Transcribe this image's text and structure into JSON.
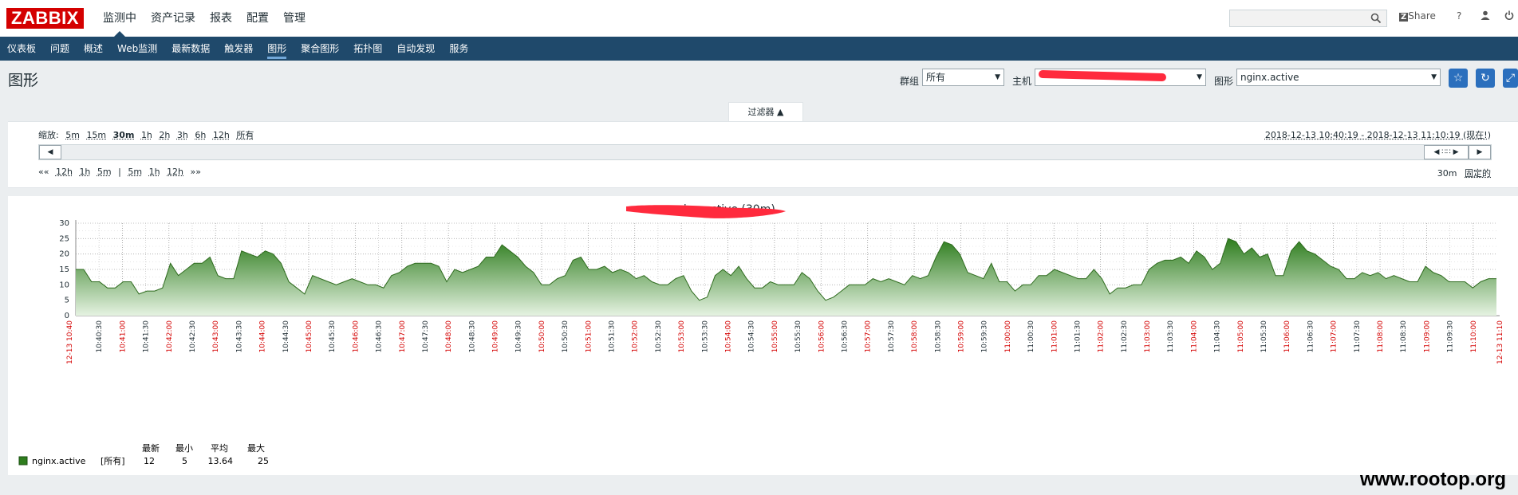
{
  "logo": "ZABBIX",
  "main_menu": [
    "监测中",
    "资产记录",
    "报表",
    "配置",
    "管理"
  ],
  "top_right": {
    "share": "Share",
    "help": "?"
  },
  "sub_menu": [
    "仪表板",
    "问题",
    "概述",
    "Web监测",
    "最新数据",
    "触发器",
    "图形",
    "聚合图形",
    "拓扑图",
    "自动发现",
    "服务"
  ],
  "page_title": "图形",
  "filters": {
    "group_label": "群组",
    "group_value": "所有",
    "host_label": "主机",
    "host_value": "",
    "graph_label": "图形",
    "graph_value": "nginx.active"
  },
  "filter_tab": "过滤器 ▲",
  "zoom": {
    "label": "缩放:",
    "options": [
      "5m",
      "15m",
      "30m",
      "1h",
      "2h",
      "3h",
      "6h",
      "12h",
      "所有"
    ],
    "active": "30m"
  },
  "time_range": "2018-12-13 10:40:19 - 2018-12-13 11:10:19 (现在!)",
  "nav": {
    "left": [
      "««",
      "12h",
      "1h",
      "5m",
      "|",
      "5m",
      "1h",
      "12h",
      "»»"
    ],
    "period": "30m",
    "fixed": "固定的"
  },
  "colors": {
    "accent": "#1f496b",
    "series": "#2e7d1e",
    "red_label": "#d40000"
  },
  "chart_data": {
    "type": "area",
    "title_suffix": ": nginx.active (30m)",
    "ylim": [
      0,
      30
    ],
    "y_ticks": [
      0,
      5,
      10,
      15,
      20,
      25,
      30
    ],
    "x_start_label": "12-13 10:40",
    "x_end_label": "12-13 11:10",
    "x_time_labels": [
      "10:40:30",
      "10:41:00",
      "10:41:30",
      "10:42:00",
      "10:42:30",
      "10:43:00",
      "10:43:30",
      "10:44:00",
      "10:44:30",
      "10:45:00",
      "10:45:30",
      "10:46:00",
      "10:46:30",
      "10:47:00",
      "10:47:30",
      "10:48:00",
      "10:48:30",
      "10:49:00",
      "10:49:30",
      "10:50:00",
      "10:50:30",
      "10:51:00",
      "10:51:30",
      "10:52:00",
      "10:52:30",
      "10:53:00",
      "10:53:30",
      "10:54:00",
      "10:54:30",
      "10:55:00",
      "10:55:30",
      "10:56:00",
      "10:56:30",
      "10:57:00",
      "10:57:30",
      "10:58:00",
      "10:58:30",
      "10:59:00",
      "10:59:30",
      "11:00:00",
      "11:00:30",
      "11:01:00",
      "11:01:30",
      "11:02:00",
      "11:02:30",
      "11:03:00",
      "11:03:30",
      "11:04:00",
      "11:04:30",
      "11:05:00",
      "11:05:30",
      "11:06:00",
      "11:06:30",
      "11:07:00",
      "11:07:30",
      "11:08:00",
      "11:08:30",
      "11:09:00",
      "11:09:30",
      "11:10:00"
    ],
    "series": [
      {
        "name": "nginx.active",
        "values": [
          15,
          15,
          11,
          11,
          9,
          9,
          11,
          11,
          7,
          8,
          8,
          9,
          17,
          13,
          15,
          17,
          17,
          19,
          13,
          12,
          12,
          21,
          20,
          19,
          21,
          20,
          17,
          11,
          9,
          7,
          13,
          12,
          11,
          10,
          11,
          12,
          11,
          10,
          10,
          9,
          13,
          14,
          16,
          17,
          17,
          17,
          16,
          11,
          15,
          14,
          15,
          16,
          19,
          19,
          23,
          21,
          19,
          16,
          14,
          10,
          10,
          12,
          13,
          18,
          19,
          15,
          15,
          16,
          14,
          15,
          14,
          12,
          13,
          11,
          10,
          10,
          12,
          13,
          8,
          5,
          6,
          13,
          15,
          13,
          16,
          12,
          9,
          9,
          11,
          10,
          10,
          10,
          14,
          12,
          8,
          5,
          6,
          8,
          10,
          10,
          10,
          12,
          11,
          12,
          11,
          10,
          13,
          12,
          13,
          19,
          24,
          23,
          20,
          14,
          13,
          12,
          17,
          11,
          11,
          8,
          10,
          10,
          13,
          13,
          15,
          14,
          13,
          12,
          12,
          15,
          12,
          7,
          9,
          9,
          10,
          10,
          15,
          17,
          18,
          18,
          19,
          17,
          21,
          19,
          15,
          17,
          25,
          24,
          20,
          22,
          19,
          20,
          13,
          13,
          21,
          24,
          21,
          20,
          18,
          16,
          15,
          12,
          12,
          14,
          13,
          14,
          12,
          13,
          12,
          11,
          11,
          16,
          14,
          13,
          11,
          11,
          11,
          9,
          11,
          12,
          12
        ]
      }
    ],
    "legend": {
      "headers": [
        "最新",
        "最小",
        "平均",
        "最大"
      ],
      "name": "nginx.active",
      "func": "[所有]",
      "values": [
        "12",
        "5",
        "13.64",
        "25"
      ]
    }
  },
  "watermark": "www.rootop.org"
}
